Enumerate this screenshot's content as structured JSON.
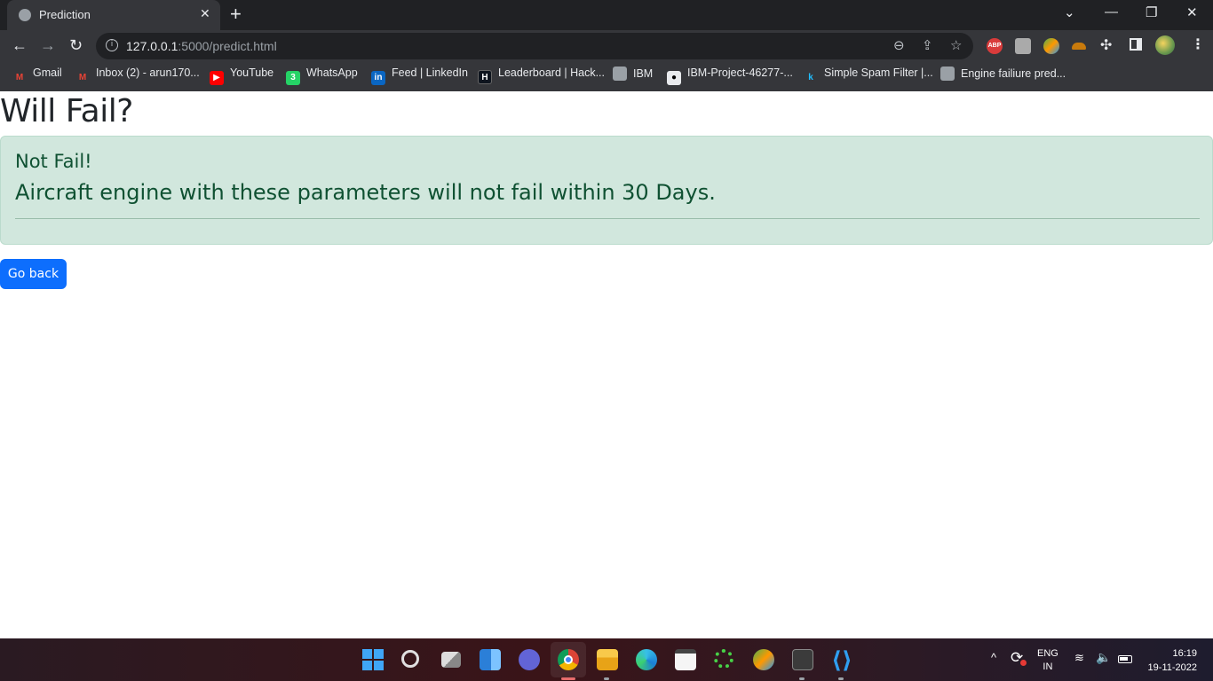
{
  "tab": {
    "title": "Prediction",
    "close_glyph": "✕",
    "new_tab_glyph": "+"
  },
  "window_controls": {
    "dropdown": "⌄",
    "minimize": "—",
    "restore": "❐",
    "close": "✕"
  },
  "nav": {
    "back": "←",
    "forward": "→",
    "reload": "↻"
  },
  "omnibox": {
    "host": "127.0.0.1",
    "path": ":5000/predict.html",
    "info_glyph": "i"
  },
  "omnibox_icons": {
    "zoom": "⊖",
    "share": "⇪",
    "star": "☆"
  },
  "extensions": {
    "abp_label": "ABP",
    "puzzle": "✣",
    "kebab": "⋮"
  },
  "bookmarks": [
    {
      "label": "Gmail",
      "icon": "gmail-icon",
      "glyph": "M"
    },
    {
      "label": "Inbox (2) - arun170...",
      "icon": "gmail-icon",
      "glyph": "M"
    },
    {
      "label": "YouTube",
      "icon": "youtube-icon",
      "glyph": "▶"
    },
    {
      "label": "WhatsApp",
      "icon": "whatsapp-icon",
      "glyph": "3"
    },
    {
      "label": "Feed | LinkedIn",
      "icon": "linkedin-icon",
      "glyph": "in"
    },
    {
      "label": "Leaderboard | Hack...",
      "icon": "hackerrank-icon",
      "glyph": "H"
    },
    {
      "label": "IBM",
      "icon": "globe-icon",
      "glyph": ""
    },
    {
      "label": "IBM-Project-46277-...",
      "icon": "github-icon",
      "glyph": "●"
    },
    {
      "label": "Simple Spam Filter |...",
      "icon": "kaggle-icon",
      "glyph": "k"
    },
    {
      "label": "Engine failiure pred...",
      "icon": "globe-icon",
      "glyph": ""
    }
  ],
  "page": {
    "heading": "Will Fail?",
    "alert_heading": "Not Fail!",
    "alert_message": "Aircraft engine with these parameters will not fail within 30 Days.",
    "back_button": "Go back"
  },
  "taskbar": {
    "apps": [
      "start",
      "search",
      "task-view",
      "widgets",
      "teams-chat",
      "chrome",
      "file-explorer",
      "edge",
      "microsoft-store",
      "app-green-spinner",
      "app-colorful",
      "terminal",
      "vscode"
    ],
    "vscode_glyph": "⟨⟩"
  },
  "tray": {
    "caret": "^",
    "sync_glyph": "⟳",
    "lang_line1": "ENG",
    "lang_line2": "IN",
    "wifi": "≋",
    "volume": "🔈",
    "time": "16:19",
    "date": "19-11-2022"
  },
  "colors": {
    "alert_bg": "#d1e7dd",
    "alert_text": "#0f5132",
    "button_primary": "#0d6efd",
    "browser_chrome": "#35363a",
    "tabstrip": "#202124"
  }
}
